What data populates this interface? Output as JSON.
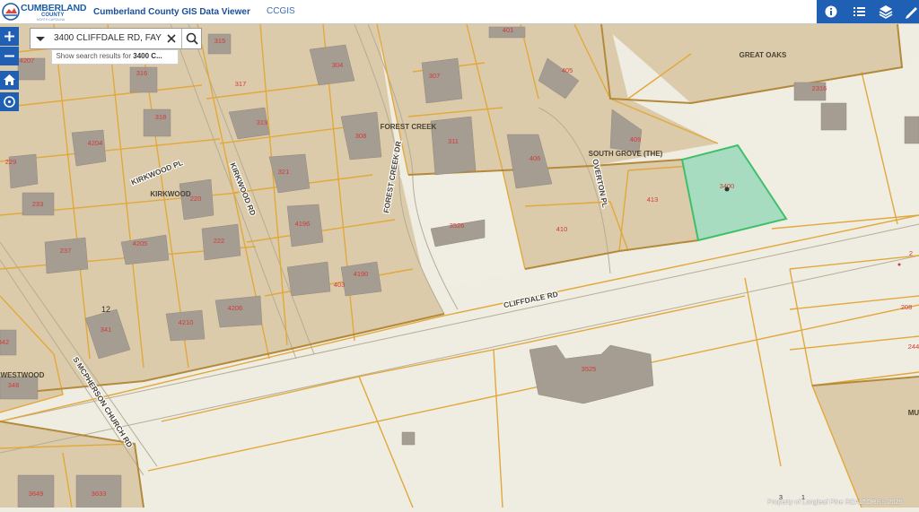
{
  "header": {
    "logo": {
      "name": "CUMBERLAND",
      "sub": "COUNTY",
      "tag": "NORTH CAROLINA"
    },
    "app_title": "Cumberland County GIS Data Viewer",
    "app_link": "CCGIS",
    "tools": [
      {
        "icon": "info-icon"
      },
      {
        "icon": "list-icon"
      },
      {
        "icon": "layers-icon"
      },
      {
        "icon": "pencil-icon"
      }
    ]
  },
  "map_controls": {
    "zoom_in": "+",
    "zoom_out": "−",
    "home_icon": "home-icon",
    "locate_icon": "locate-icon"
  },
  "search": {
    "value": "3400 CLIFFDALE RD, FAY",
    "suggestion_prefix": "Show search results for",
    "suggestion_query": "3400 C..."
  },
  "map": {
    "streets": [
      {
        "name": "CLIFFDALE RD"
      },
      {
        "name": "KIRKWOOD RD"
      },
      {
        "name": "KIRKWOOD PL"
      },
      {
        "name": "FOREST CREEK DR"
      },
      {
        "name": "OVERTON PL"
      },
      {
        "name": "S MCPHERSON CHURCH RD"
      }
    ],
    "subdivisions": [
      {
        "name": "GREAT OAKS"
      },
      {
        "name": "FOREST CREEK"
      },
      {
        "name": "SOUTH GROVE (THE)"
      },
      {
        "name": "KIRKWOOD"
      },
      {
        "name": "WESTWOOD"
      },
      {
        "name": "MU"
      }
    ],
    "address_labels": [
      "315",
      "401",
      "4207",
      "316",
      "304",
      "307",
      "405",
      "2316",
      "318",
      "317",
      "4204",
      "319",
      "308",
      "311",
      "409",
      "229",
      "406",
      "3400",
      "321",
      "233",
      "220",
      "413",
      "3526",
      "222",
      "4205",
      "410",
      "237",
      "4190",
      "4196",
      "208",
      "12",
      "4206",
      "4210",
      "341",
      "244",
      "342",
      "3525",
      "348",
      "3649",
      "3633",
      "3",
      "1",
      "403",
      "2"
    ],
    "selected_parcel": "3400",
    "colors": {
      "selected_fill": "#a8dcc0",
      "selected_outline": "#3fbf6a",
      "parcel_outline": "#e2a83c",
      "address_label": "#d33b3b"
    }
  },
  "attribution": "Property of Longleaf Pine REALTORS® 2025"
}
